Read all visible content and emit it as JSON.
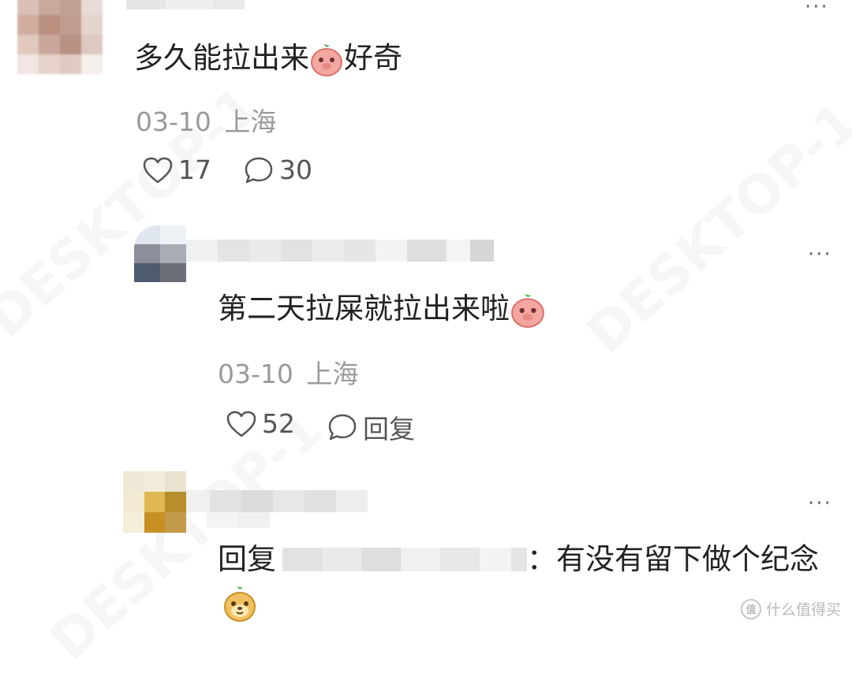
{
  "comments": [
    {
      "text": "多久能拉出来",
      "text_suffix": "好奇",
      "date": "03-10",
      "location": "上海",
      "likes": "17",
      "replies": "30"
    }
  ],
  "reply": {
    "text": "第二天拉屎就拉出来啦",
    "date": "03-10",
    "location": "上海",
    "likes": "52",
    "reply_label": "回复"
  },
  "reply2": {
    "prefix": "回复",
    "text": "：有没有留下做个纪念"
  },
  "more_label": "···",
  "logo": {
    "text": "什么值得买",
    "mark": "值"
  },
  "icons": {
    "like": "heart-outline-icon",
    "comment": "speech-bubble-icon",
    "emoji_peach": "peach-shy-emoji",
    "emoji_dog": "dog-face-emoji"
  }
}
